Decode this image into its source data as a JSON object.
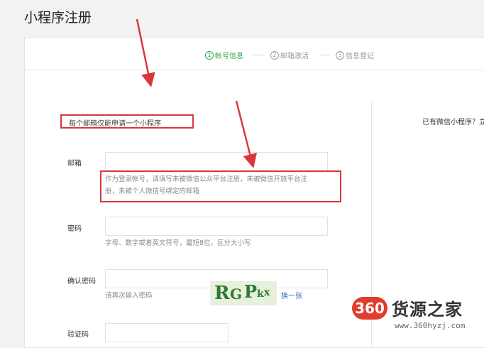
{
  "page": {
    "title": "小程序注册"
  },
  "steps": [
    {
      "num": "1",
      "label": "帐号信息"
    },
    {
      "num": "2",
      "label": "邮箱激活"
    },
    {
      "num": "3",
      "label": "信息登记"
    }
  ],
  "notice": "每个邮箱仅能申请一个小程序",
  "side": {
    "login_text": "已有微信小程序？立"
  },
  "form": {
    "email": {
      "label": "邮箱",
      "value": "",
      "help_line1": "作为登录帐号，请填写未被微信公众平台注册，未被微信开放平台注",
      "help_line2": "册，未被个人微信号绑定的邮箱"
    },
    "password": {
      "label": "密码",
      "value": "",
      "help": "字母、数字或者英文符号，最短8位，区分大小写"
    },
    "confirm": {
      "label": "确认密码",
      "value": "",
      "help": "请再次输入密码"
    },
    "captcha": {
      "label": "验证码",
      "value": "",
      "image_text": "RGPkx",
      "swap_label": "换一张"
    }
  },
  "colors": {
    "accent": "#2aa74b",
    "highlight": "#d9373b",
    "link": "#3b6fc4"
  },
  "watermark": {
    "logo": "360",
    "name": "货源之家",
    "url": "www.360hyzj.com"
  }
}
